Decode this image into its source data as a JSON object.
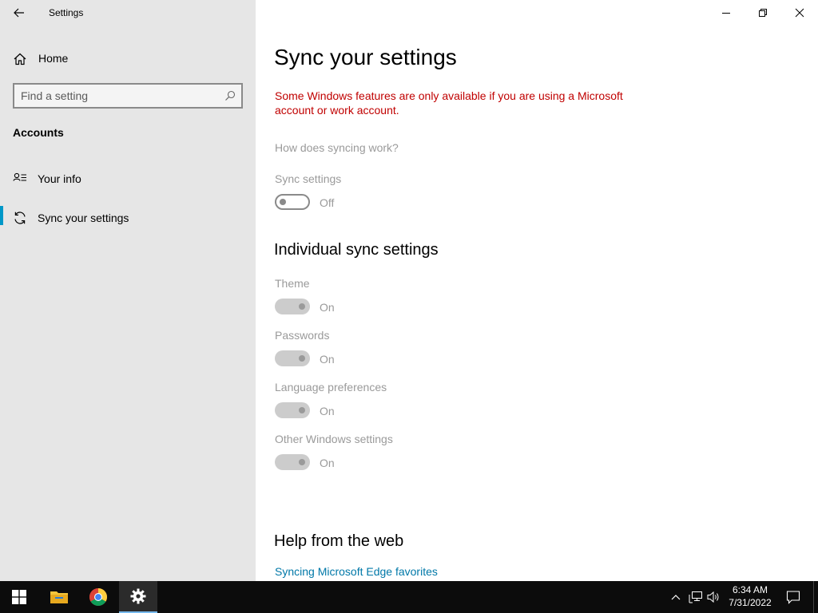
{
  "app": {
    "title": "Settings"
  },
  "sidebar": {
    "home_label": "Home",
    "search_placeholder": "Find a setting",
    "section_heading": "Accounts",
    "items": [
      {
        "label": "Your info",
        "icon": "person-list-icon",
        "selected": false
      },
      {
        "label": "Sync your settings",
        "icon": "sync-icon",
        "selected": true
      }
    ]
  },
  "main": {
    "title": "Sync your settings",
    "warning": "Some Windows features are only available if you are using a Microsoft account or work account.",
    "how_link": "How does syncing work?",
    "sync": {
      "label": "Sync settings",
      "state": "Off"
    },
    "individual_heading": "Individual sync settings",
    "individual": [
      {
        "label": "Theme",
        "state": "On"
      },
      {
        "label": "Passwords",
        "state": "On"
      },
      {
        "label": "Language preferences",
        "state": "On"
      },
      {
        "label": "Other Windows settings",
        "state": "On"
      }
    ],
    "help_heading": "Help from the web",
    "help_link": "Syncing Microsoft Edge favorites"
  },
  "taskbar": {
    "clock_time": "6:34 AM",
    "clock_date": "7/31/2022",
    "accent": "#76b9ed"
  },
  "colors": {
    "warning": "#c00000",
    "link": "#0078a8",
    "selection_bar": "#0098c8",
    "sidebar_bg": "#e6e6e6"
  }
}
